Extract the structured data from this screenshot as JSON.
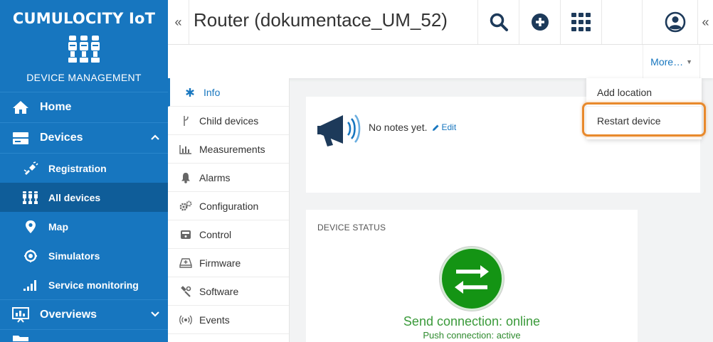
{
  "brand": {
    "name": "CUMULOCITY IoT",
    "subtitle": "DEVICE MANAGEMENT"
  },
  "sidebar": {
    "items": [
      {
        "label": "Home",
        "icon": "home-icon"
      },
      {
        "label": "Devices",
        "icon": "devices-icon",
        "caret": "^"
      },
      {
        "label": "Registration",
        "icon": "registration-icon"
      },
      {
        "label": "All devices",
        "icon": "all-devices-icon",
        "active": true
      },
      {
        "label": "Map",
        "icon": "map-marker-icon"
      },
      {
        "label": "Simulators",
        "icon": "simulators-icon"
      },
      {
        "label": "Service monitoring",
        "icon": "signal-icon"
      },
      {
        "label": "Overviews",
        "icon": "overviews-icon",
        "caret": "⌄"
      }
    ]
  },
  "header": {
    "collapse_left": "«",
    "title": "Router (dokumentace_UM_52)",
    "collapse_right": "«"
  },
  "actionbar": {
    "more_label": "More…",
    "more_caret": "▼"
  },
  "dropdown": {
    "items": [
      "Add location",
      "Restart device"
    ]
  },
  "tabs": [
    {
      "label": "Info",
      "icon": "asterisk-icon",
      "active": true
    },
    {
      "label": "Child devices",
      "icon": "child-devices-icon"
    },
    {
      "label": "Measurements",
      "icon": "measurements-icon"
    },
    {
      "label": "Alarms",
      "icon": "bell-icon"
    },
    {
      "label": "Configuration",
      "icon": "gears-icon"
    },
    {
      "label": "Control",
      "icon": "control-icon"
    },
    {
      "label": "Firmware",
      "icon": "firmware-icon"
    },
    {
      "label": "Software",
      "icon": "software-icon"
    },
    {
      "label": "Events",
      "icon": "events-icon"
    }
  ],
  "notes": {
    "text": "No notes yet.",
    "edit_label": "Edit"
  },
  "status": {
    "title": "DEVICE STATUS",
    "send": "Send connection: online",
    "push": "Push connection: active"
  },
  "colors": {
    "sidebar": "#1776bf",
    "sidebar_active": "#0f5d99",
    "accent": "#1776bf",
    "online_green": "#149414",
    "highlight": "#e8892c"
  }
}
